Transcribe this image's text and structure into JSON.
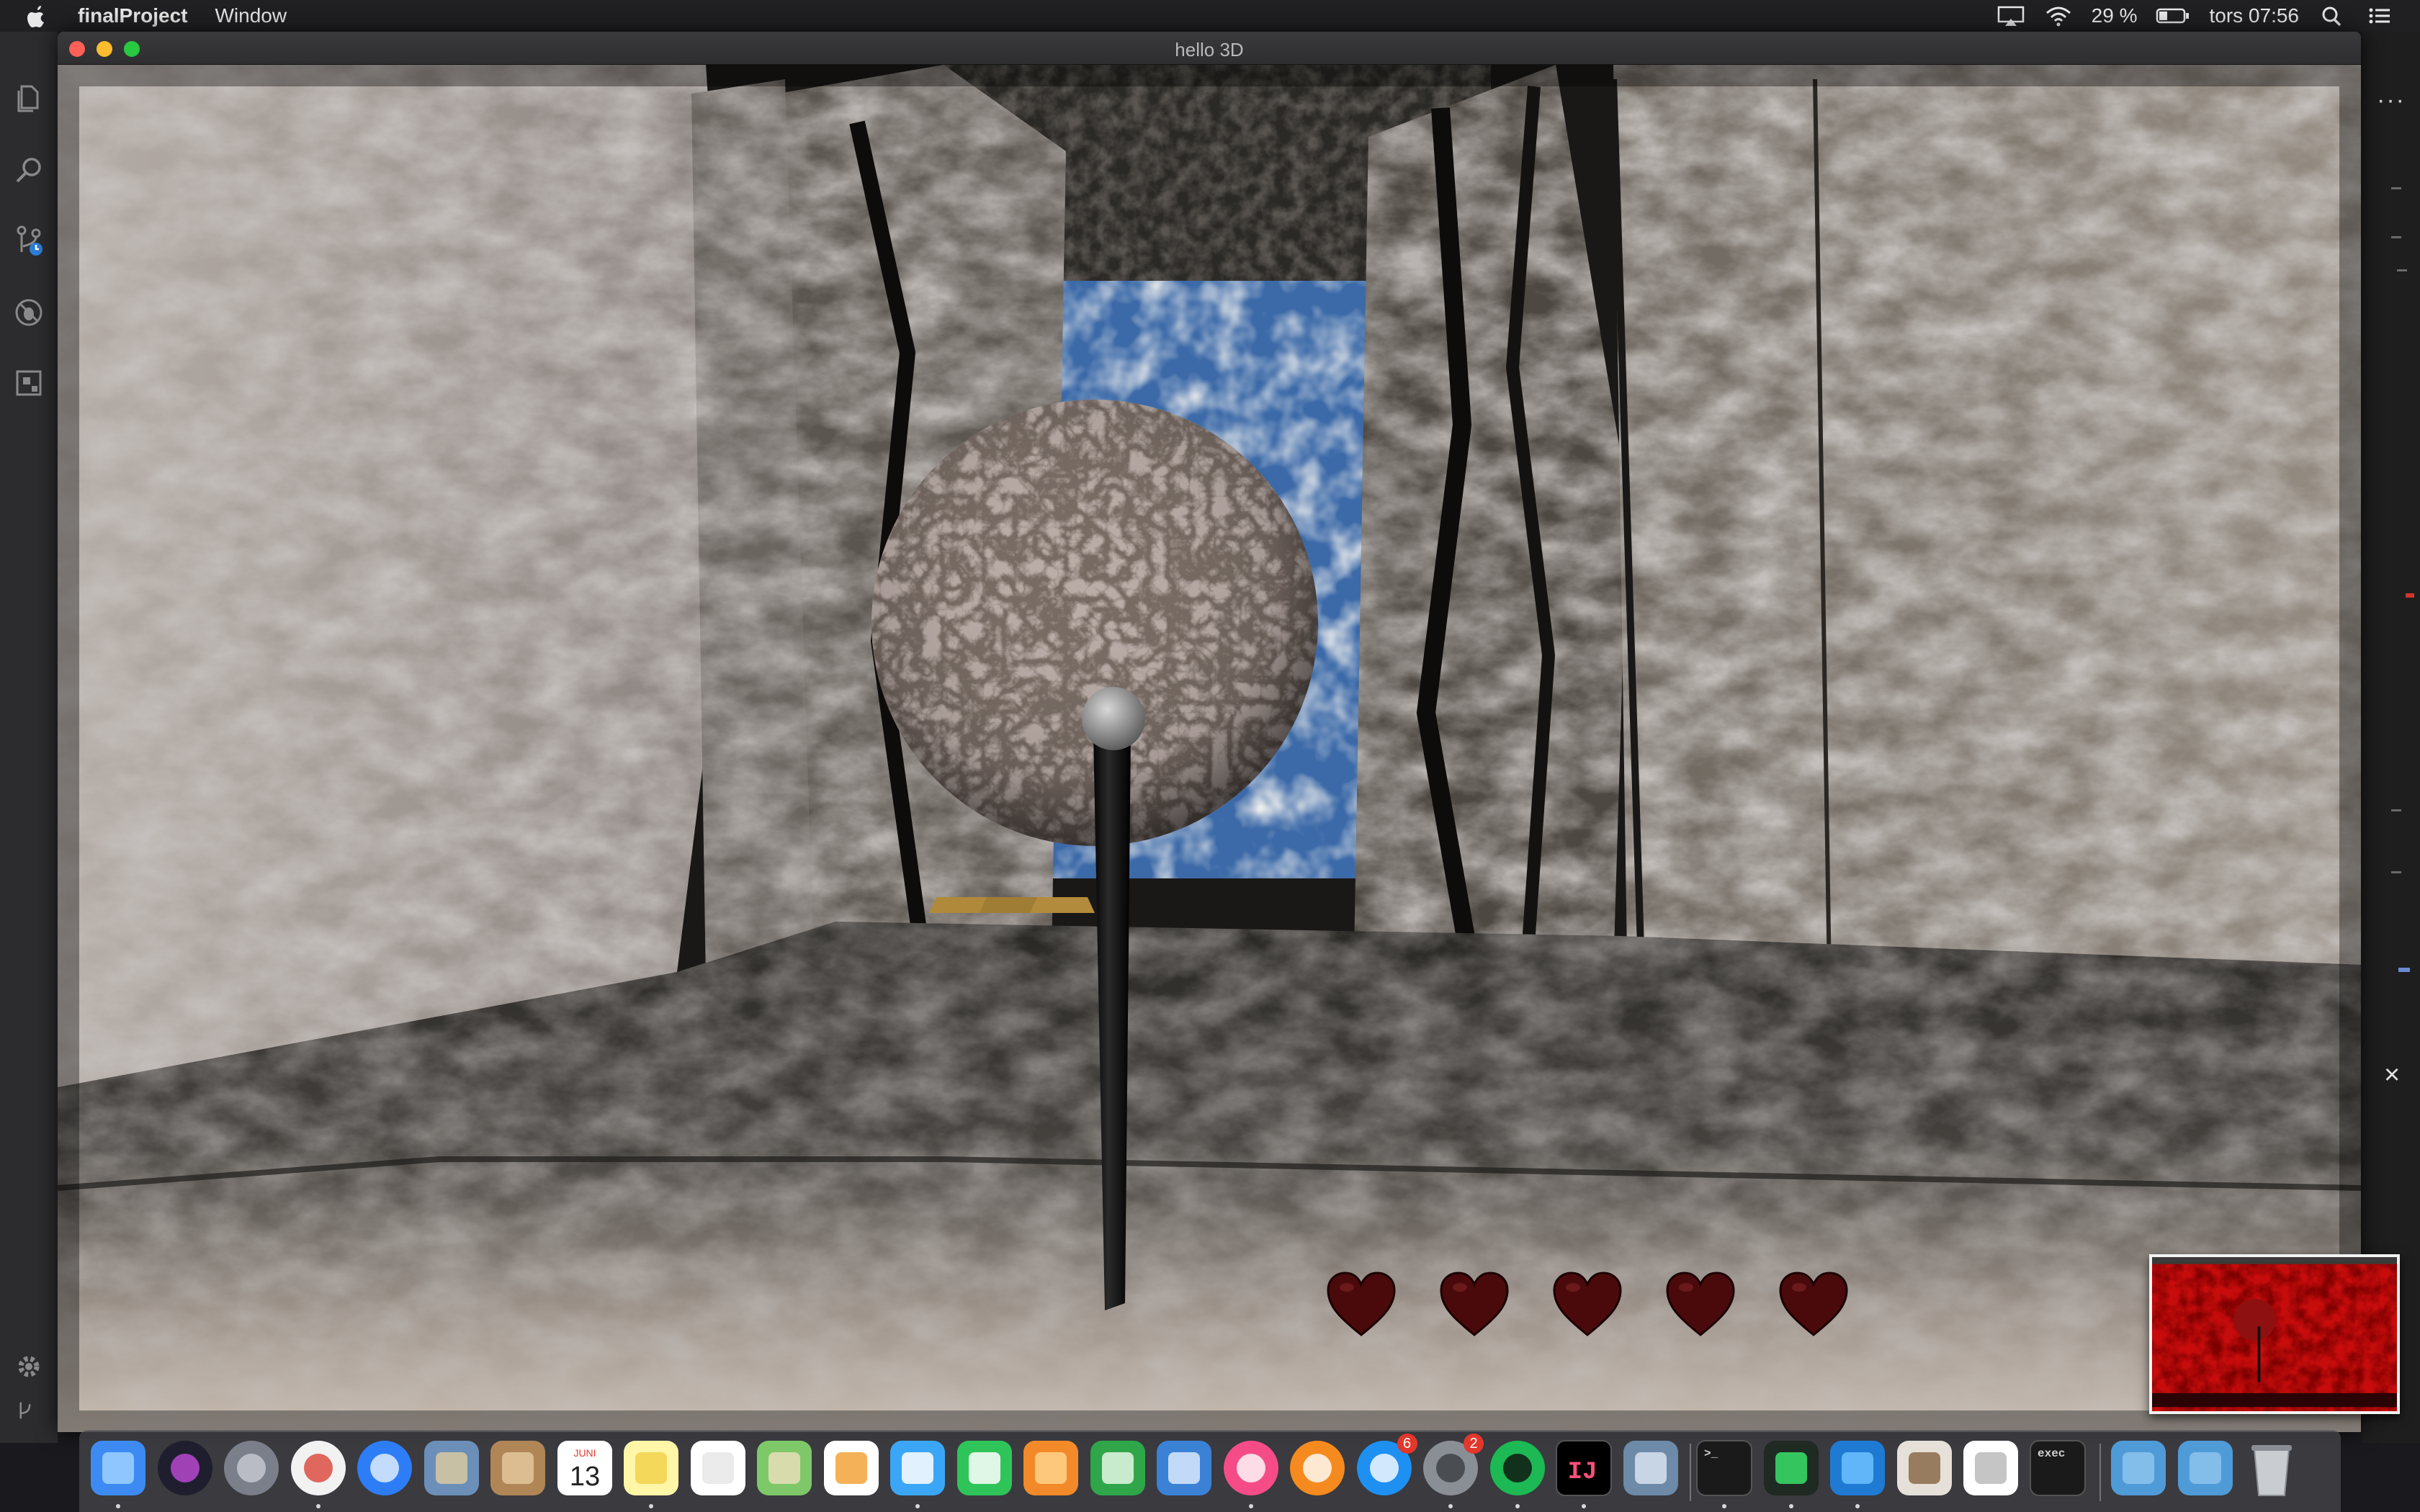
{
  "menubar": {
    "app_name": "finalProject",
    "menus": [
      "Window"
    ],
    "battery": "29 %",
    "clock": "tors 07:56",
    "icons": [
      "apple-icon",
      "airplay-icon",
      "wifi-icon",
      "battery-icon",
      "spotlight-icon",
      "notification-center-icon"
    ]
  },
  "window": {
    "title": "hello 3D",
    "traffic_lights": {
      "close": "#fe5f57",
      "minimize": "#febc2e",
      "zoom": "#28c840"
    }
  },
  "vscode": {
    "activity_icons": [
      "explorer-icon",
      "search-icon",
      "source-control-icon",
      "debug-icon",
      "extensions-icon"
    ],
    "bottom_icons": [
      "gear-icon",
      "branch-icon"
    ],
    "more_label": "···",
    "close_label": "×"
  },
  "game": {
    "lives": 5,
    "max_lives": 5,
    "heart_color": "#4a0a0c"
  },
  "dock": {
    "apps": [
      {
        "name": "finder",
        "running": true
      },
      {
        "name": "siri",
        "running": false
      },
      {
        "name": "launchpad",
        "running": false
      },
      {
        "name": "chrome",
        "running": true
      },
      {
        "name": "safari",
        "running": false
      },
      {
        "name": "preview-eagle",
        "running": false
      },
      {
        "name": "contacts",
        "running": false
      },
      {
        "name": "calendar",
        "running": false,
        "month": "JUNI",
        "day": "13"
      },
      {
        "name": "notes",
        "running": true
      },
      {
        "name": "reminders",
        "running": false
      },
      {
        "name": "maps",
        "running": false
      },
      {
        "name": "photos",
        "running": false
      },
      {
        "name": "messages",
        "running": true
      },
      {
        "name": "facetime",
        "running": false
      },
      {
        "name": "keynote-pages",
        "running": false
      },
      {
        "name": "numbers",
        "running": false
      },
      {
        "name": "keynote",
        "running": false
      },
      {
        "name": "itunes",
        "running": true
      },
      {
        "name": "books",
        "running": false
      },
      {
        "name": "app-store",
        "running": false,
        "badge": "6"
      },
      {
        "name": "system-preferences",
        "running": true,
        "badge": "2"
      },
      {
        "name": "spotify",
        "running": true
      },
      {
        "name": "intellij",
        "running": true,
        "label": "IJ"
      },
      {
        "name": "image-capture",
        "running": false
      },
      {
        "name": "terminal",
        "running": true
      },
      {
        "name": "activity-monitor",
        "running": true
      },
      {
        "name": "vscode",
        "running": true
      },
      {
        "name": "archive",
        "running": false
      },
      {
        "name": "textedit",
        "running": false
      },
      {
        "name": "exec",
        "running": false,
        "label": "exec"
      },
      {
        "name": "downloads-folder",
        "running": false
      },
      {
        "name": "documents-folder",
        "running": false
      },
      {
        "name": "trash",
        "running": false
      }
    ]
  }
}
